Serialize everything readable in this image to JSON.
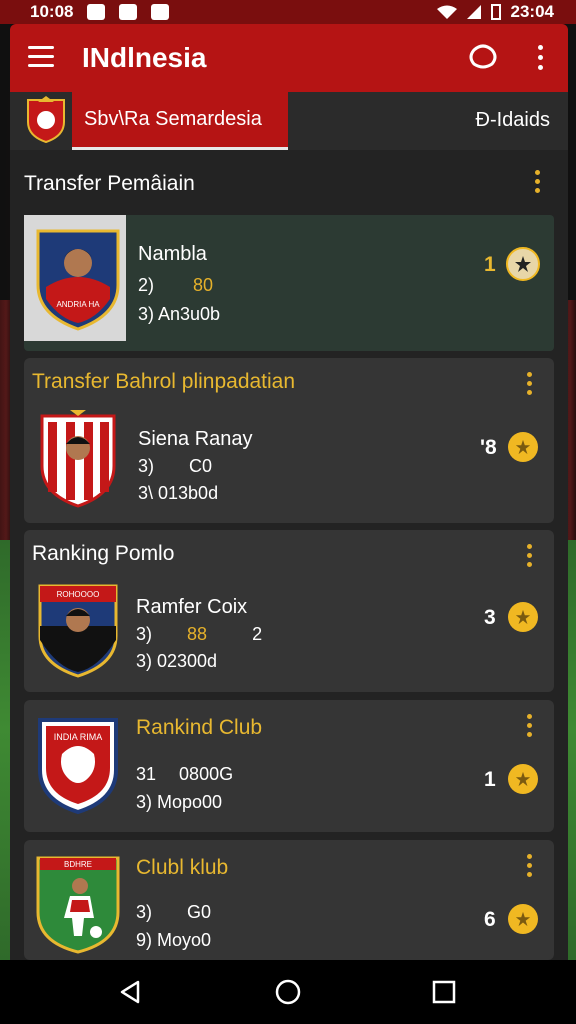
{
  "status_bar": {
    "time_left": "10:08",
    "time_right": "23:04"
  },
  "app_bar": {
    "title": "INdlnesia",
    "menu_icon": "menu-icon",
    "chat_icon": "chat-icon",
    "more_icon": "more-vert-icon"
  },
  "tabs": {
    "active_label": "Sbv\\Ra Semardesia",
    "other_label": "Ð-Idaids"
  },
  "section": {
    "title": "Transfer Pemâiain"
  },
  "cards": [
    {
      "name": "Nambla",
      "line1_prefix": "2)",
      "line1_value": "80",
      "line2": "3)  An3u0b",
      "rank": "1"
    },
    {
      "header": "Transfer Bahrol plinpadatian",
      "name": "Siena Ranay",
      "line1_prefix": "3)",
      "line1_value": "C0",
      "line2": "3\\  013b0d",
      "rank": "'8"
    },
    {
      "header": "Ranking Pomlo",
      "name": "Ramfer Coix",
      "line1_prefix": "3)",
      "line1_value": "88",
      "line1_extra": "2",
      "line2": "3)  02300d",
      "rank": "3"
    },
    {
      "header": "Rankind Club",
      "line1_prefix": "31",
      "line1_value": "0800G",
      "line2": "3)  Mopo00",
      "rank": "1"
    },
    {
      "header": "Clubl klub",
      "line1_prefix": "3)",
      "line1_value": "G0",
      "line2": "9)  Moyo0",
      "rank": "6"
    }
  ],
  "crest_text": {
    "card1": "ANDRIA HA",
    "card3": "ROHOOOO",
    "card4": "INDIA RIMA",
    "card5": "BDHRE"
  },
  "colors": {
    "brand_red": "#b51414",
    "accent_yellow": "#e8b830",
    "panel": "#232323",
    "card": "#353535"
  },
  "nav": {
    "back_icon": "back-icon",
    "home_icon": "home-icon",
    "recents_icon": "recents-icon"
  }
}
